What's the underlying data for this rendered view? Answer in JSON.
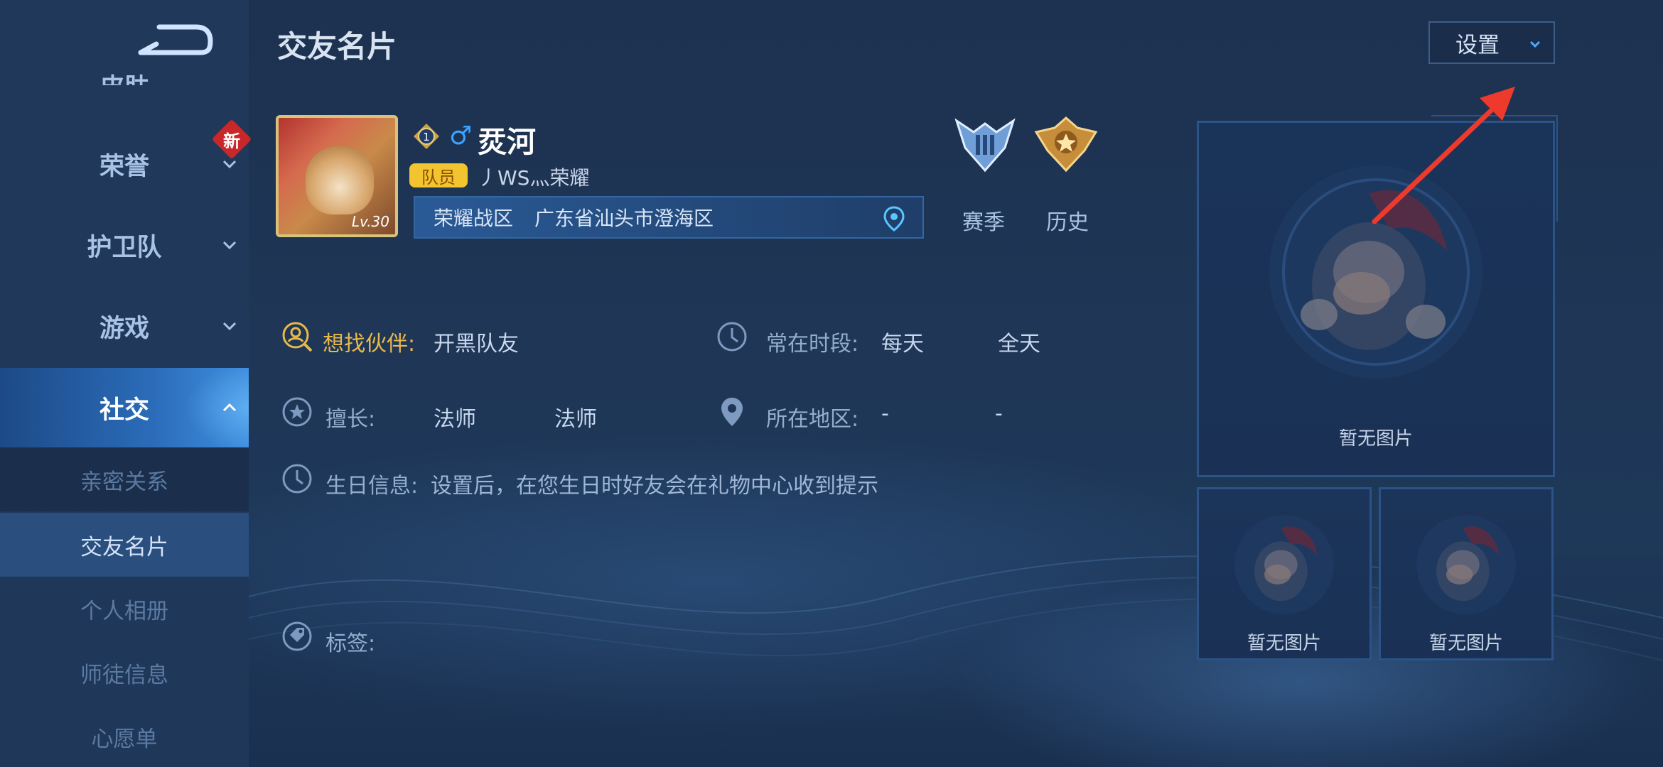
{
  "sidebar": {
    "partial_top_label": "皮肤",
    "items": [
      {
        "label": "荣誉",
        "badge": "新"
      },
      {
        "label": "护卫队"
      },
      {
        "label": "游戏"
      },
      {
        "label": "社交"
      }
    ],
    "sub_items": [
      "亲密关系",
      "交友名片",
      "个人相册",
      "师徒信息",
      "心愿单"
    ],
    "selected_sub": "交友名片"
  },
  "header": {
    "title": "交友名片",
    "settings_label": "设置"
  },
  "profile": {
    "avatar_level": "Lv.30",
    "rank_number": "1",
    "gender_icon": "male-icon",
    "name": "烎河",
    "role_badge": "队员",
    "team_name": "丿WS灬荣耀",
    "zone_label": "荣耀战区",
    "zone_location": "广东省汕头市澄海区"
  },
  "medals": {
    "season_label": "赛季",
    "history_label": "历史"
  },
  "info": {
    "partner_label": "想找伙伴:",
    "partner_value": "开黑队友",
    "time_label": "常在时段:",
    "time_days": "每天",
    "time_span": "全天",
    "skill_label": "擅长:",
    "skill_1": "法师",
    "skill_2": "法师",
    "region_label": "所在地区:",
    "region_1": "-",
    "region_2": "-",
    "birthday_label": "生日信息:",
    "birthday_value": "设置后，在您生日时好友会在礼物中心收到提示",
    "tags_label": "标签:"
  },
  "photos": {
    "main_label": "暂无图片",
    "small_1_label": "暂无图片",
    "small_2_label": "暂无图片"
  },
  "colors": {
    "accent_gold": "#e7b94c",
    "active_blue": "#2a6bb8",
    "annotation_arrow": "#ee3a2c"
  }
}
